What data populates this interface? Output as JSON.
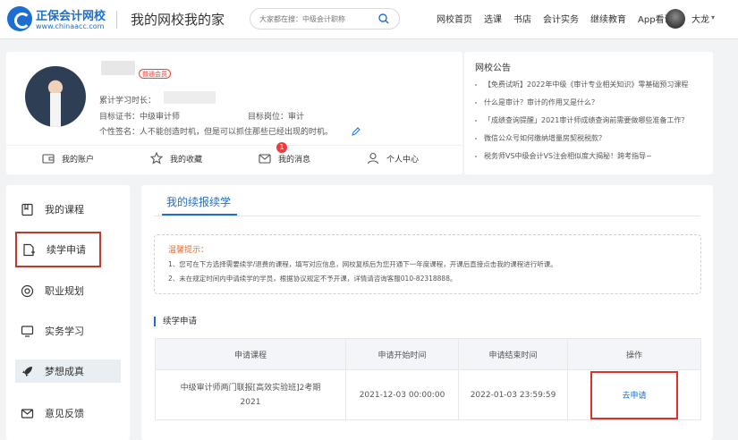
{
  "header": {
    "logo_name": "正保会计网校",
    "logo_url": "www.chinaacc.com",
    "slogan": "我的网校我的家",
    "search_placeholder": "大家都在搜：中级会计职称",
    "nav": [
      "网校首页",
      "选课",
      "书店",
      "会计实务",
      "继续教育",
      "App看课"
    ],
    "user_name": "大龙",
    "brand_color": "#1c6fd1"
  },
  "profile": {
    "member_badge": "普通会员",
    "study_hours_label": "累计学习时长：",
    "cert_label": "目标证书：",
    "cert_value": "中级审计师",
    "job_label": "目标岗位：",
    "job_value": "审计",
    "signature_label": "个性签名：",
    "signature_value": "人不能创造时机，但是可以抓住那些已经出现的时机。",
    "quick_links": {
      "account": "我的账户",
      "favorites": "我的收藏",
      "messages": "我的消息",
      "messages_count": "1",
      "personal": "个人中心"
    }
  },
  "notice": {
    "title": "网校公告",
    "items": [
      "【免费试听】2022年中级《审计专业相关知识》零基础预习课程",
      "什么是审计？审计的作用又是什么？",
      "「成绩查询提醒」2021审计师成绩查询前需要做哪些准备工作？",
      "微信公众号如何缴纳增量房契税税款？",
      "税务师VS中级会计VS注会相似度大揭秘！跨考指导~"
    ]
  },
  "sidebar": {
    "items": [
      {
        "label": "我的课程",
        "icon": "book-icon"
      },
      {
        "label": "续学申请",
        "icon": "apply-icon"
      },
      {
        "label": "职业规划",
        "icon": "target-icon"
      },
      {
        "label": "实务学习",
        "icon": "monitor-icon"
      },
      {
        "label": "梦想成真",
        "icon": "rocket-icon"
      },
      {
        "label": "意见反馈",
        "icon": "mail-icon"
      }
    ]
  },
  "main": {
    "tab": "我的续报续学",
    "tips_title": "温馨提示：",
    "tips": [
      "1、您可在下方选择需要续学/退费的课程，填写对应信息，网校复核后为您开通下一年度课程，开课后直接点击我的课程进行听课。",
      "2、未在规定时间内申请续学的学员，根据协议规定不予开课，详情请咨询客服010-82318888。"
    ],
    "section_title": "续学申请",
    "table": {
      "headers": [
        "申请课程",
        "申请开始时间",
        "申请结束时间",
        "操作"
      ],
      "row": {
        "course_line1": "中级审计师两门联报[高效实验班]2考期",
        "course_line2": "2021",
        "start": "2021-12-03 00:00:00",
        "end": "2022-01-03 23:59:59",
        "action": "去申请"
      }
    }
  }
}
